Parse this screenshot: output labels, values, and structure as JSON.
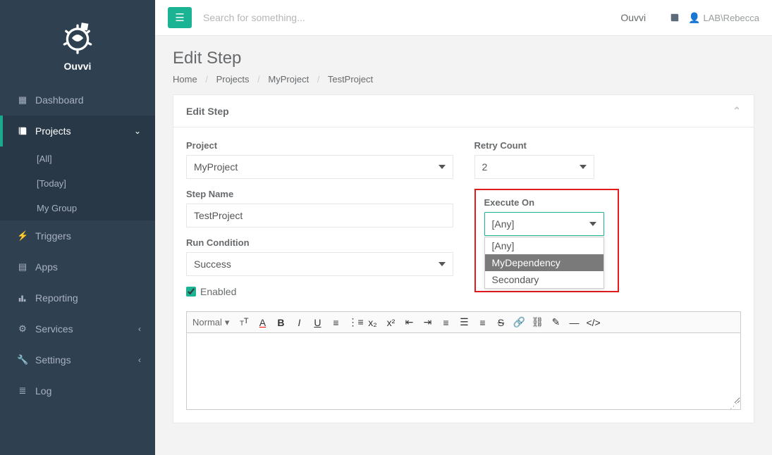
{
  "brand": {
    "name": "Ouvvi"
  },
  "topbar": {
    "search_placeholder": "Search for something...",
    "app_title": "Ouvvi",
    "user_label": "LAB\\Rebecca"
  },
  "page": {
    "title": "Edit Step",
    "breadcrumbs": [
      "Home",
      "Projects",
      "MyProject",
      "TestProject"
    ]
  },
  "sidebar": {
    "items": [
      {
        "icon": "dashboard",
        "label": "Dashboard"
      },
      {
        "icon": "book",
        "label": "Projects",
        "expanded": true,
        "sub": [
          "[All]",
          "[Today]",
          "My Group"
        ]
      },
      {
        "icon": "bolt",
        "label": "Triggers"
      },
      {
        "icon": "apps",
        "label": "Apps"
      },
      {
        "icon": "chart",
        "label": "Reporting"
      },
      {
        "icon": "cogs",
        "label": "Services",
        "caret": true
      },
      {
        "icon": "wrench",
        "label": "Settings",
        "caret": true
      },
      {
        "icon": "list",
        "label": "Log"
      }
    ]
  },
  "panel": {
    "title": "Edit Step"
  },
  "form": {
    "project_label": "Project",
    "project_value": "MyProject",
    "stepname_label": "Step Name",
    "stepname_value": "TestProject",
    "runcond_label": "Run Condition",
    "runcond_value": "Success",
    "retry_label": "Retry Count",
    "retry_value": "2",
    "execute_label": "Execute On",
    "execute_value": "[Any]",
    "execute_options": [
      "[Any]",
      "MyDependency",
      "Secondary"
    ],
    "enabled_label": "Enabled",
    "enabled_checked": true
  },
  "editor": {
    "format": "Normal"
  }
}
